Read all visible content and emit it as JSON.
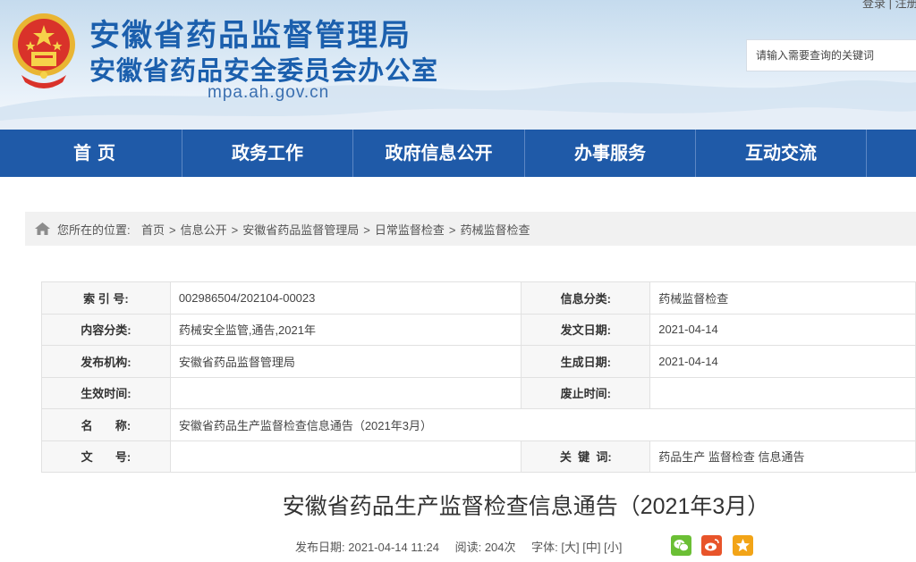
{
  "header": {
    "title": "安徽省药品监督管理局",
    "subtitle": "安徽省药品安全委员会办公室",
    "domain": "mpa.ah.gov.cn",
    "login_link": "登录 | 注册",
    "search_placeholder": "请输入需要查询的关键词"
  },
  "nav": {
    "items": [
      "首 页",
      "政务工作",
      "政府信息公开",
      "办事服务",
      "互动交流"
    ]
  },
  "breadcrumb": {
    "prefix": "您所在的位置:",
    "items": [
      "首页",
      "信息公开",
      "安徽省药品监督管理局",
      "日常监督检查",
      "药械监督检查"
    ],
    "separator": ">"
  },
  "info": {
    "index_no_label": "索  引  号:",
    "index_no": "002986504/202104-00023",
    "info_category_label": "信息分类:",
    "info_category": "药械监督检查",
    "content_category_label": "内容分类:",
    "content_category": "药械安全监管,通告,2021年",
    "issue_date_label": "发文日期:",
    "issue_date": "2021-04-14",
    "publisher_label": "发布机构:",
    "publisher": "安徽省药品监督管理局",
    "generate_date_label": "生成日期:",
    "generate_date": "2021-04-14",
    "effective_date_label": "生效时间:",
    "effective_date": "",
    "expiry_date_label": "废止时间:",
    "expiry_date": "",
    "name_label": "名       称:",
    "name": "安徽省药品生产监督检查信息通告（2021年3月）",
    "doc_no_label": "文       号:",
    "doc_no": "",
    "keywords_label": "关  键  词:",
    "keywords": "药品生产 监督检查 信息通告"
  },
  "article": {
    "title": "安徽省药品生产监督检查信息通告（2021年3月）",
    "publish_label": "发布日期:",
    "publish_datetime": "2021-04-14 11:24",
    "views_label": "阅读:",
    "views": "204次",
    "font_label": "字体:",
    "font_large": "[大]",
    "font_medium": "[中]",
    "font_small": "[小]"
  },
  "share": {
    "icons": [
      "wechat-icon",
      "weibo-icon",
      "favorite-icon"
    ],
    "colors": {
      "wechat": "#6bbf35",
      "weibo": "#e8542a",
      "favorite": "#f2a417"
    }
  },
  "colors": {
    "brand_blue": "#1b5fad",
    "nav_blue": "#1f5aa8",
    "table_label_bg": "#f7f7f7",
    "breadcrumb_bg": "#f1f1f1"
  }
}
